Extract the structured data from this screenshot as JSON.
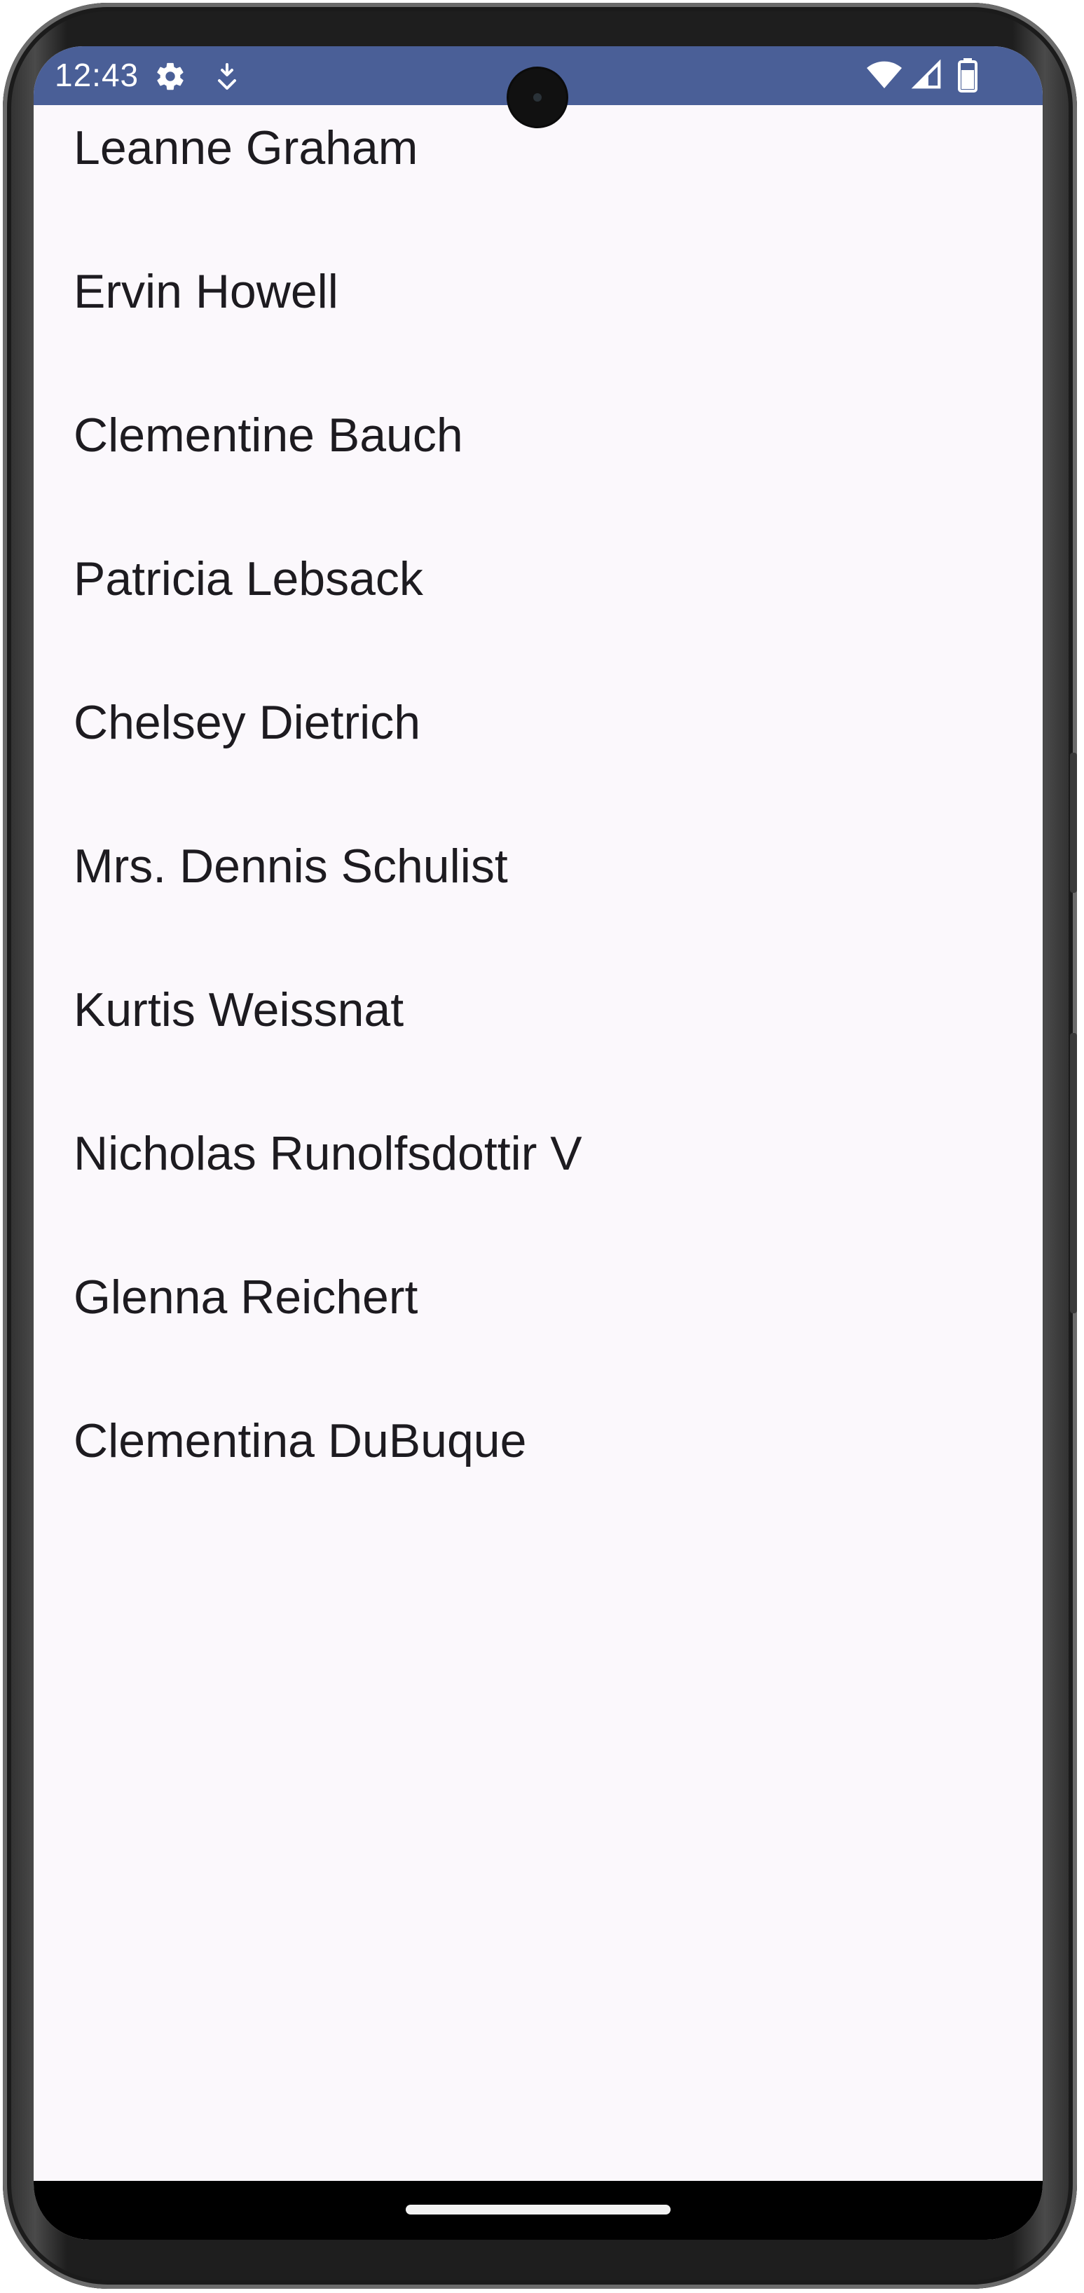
{
  "status_bar": {
    "time": "12:43",
    "icons": [
      "settings-gear-icon",
      "download-notification-icon",
      "wifi-icon",
      "cellular-signal-icon",
      "battery-icon"
    ],
    "background_color": "#4a5f97"
  },
  "contacts": {
    "items": [
      {
        "name": "Leanne Graham"
      },
      {
        "name": "Ervin Howell"
      },
      {
        "name": "Clementine Bauch"
      },
      {
        "name": "Patricia Lebsack"
      },
      {
        "name": "Chelsey Dietrich"
      },
      {
        "name": "Mrs. Dennis Schulist"
      },
      {
        "name": "Kurtis Weissnat"
      },
      {
        "name": "Nicholas Runolfsdottir V"
      },
      {
        "name": "Glenna Reichert"
      },
      {
        "name": "Clementina DuBuque"
      }
    ]
  },
  "colors": {
    "screen_background": "#fbf8fc",
    "text": "#1d1b20",
    "nav_bar": "#000000"
  }
}
